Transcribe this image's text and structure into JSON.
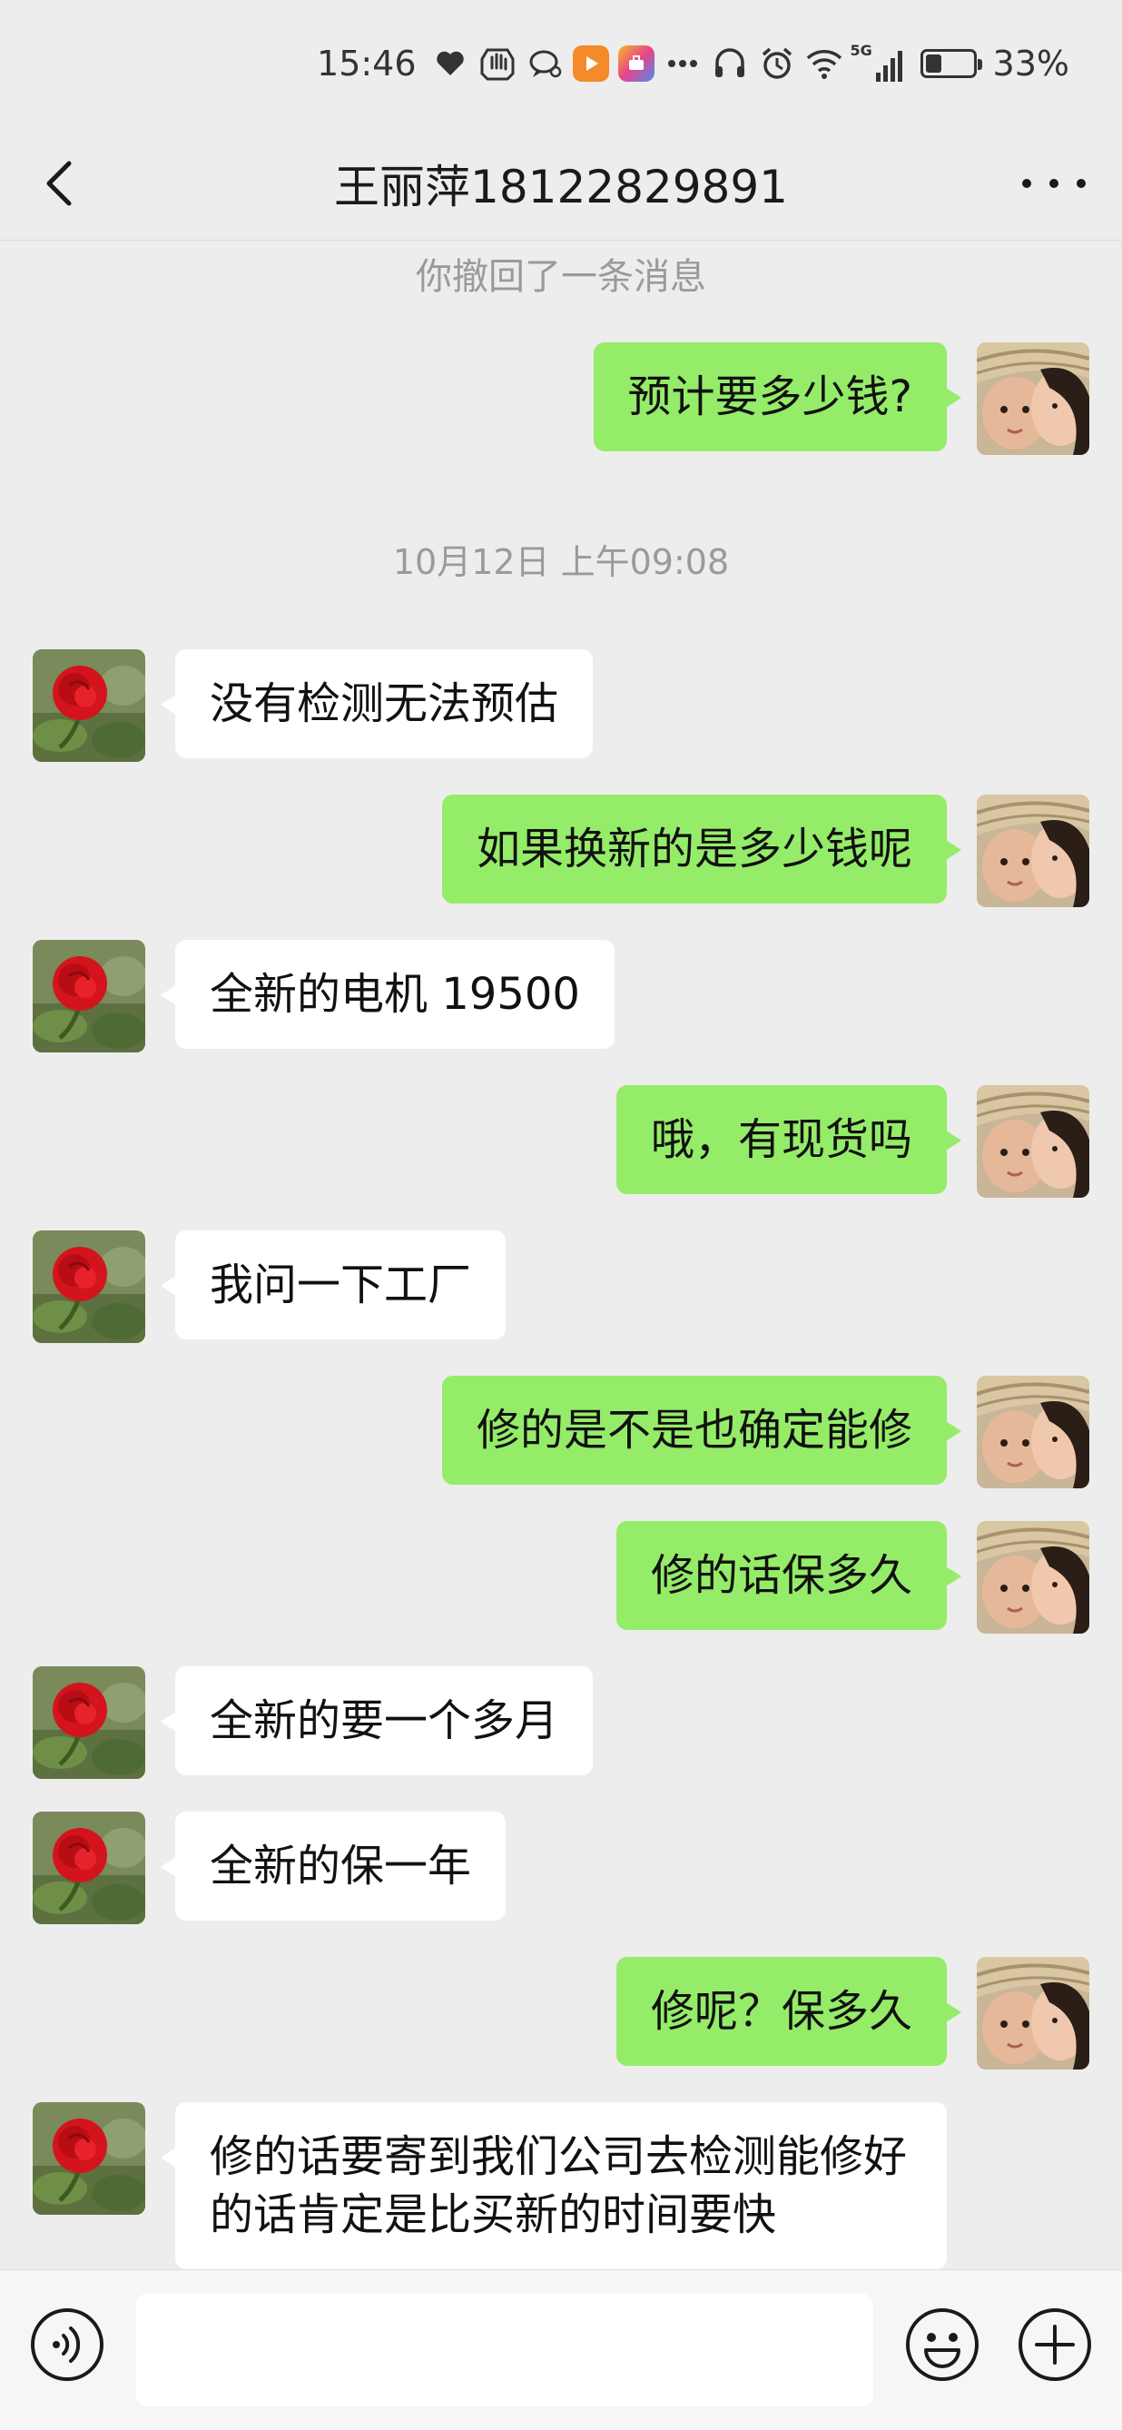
{
  "status_bar": {
    "time": "15:46",
    "network": "5G",
    "battery_percent": "33%",
    "battery_level": 0.33,
    "icons": [
      "heart-icon",
      "hand-icon",
      "chat-bubble-icon",
      "video-app-icon",
      "toolbox-app-icon",
      "more-dots-icon",
      "headphones-icon",
      "alarm-icon",
      "wifi-icon",
      "signal-icon",
      "battery-icon"
    ]
  },
  "header": {
    "title": "王丽萍18122829891",
    "back_icon": "chevron-left-icon",
    "more_icon": "more-icon"
  },
  "system_messages": {
    "recalled": "你撤回了一条消息",
    "timestamp": "10月12日 上午09:08"
  },
  "messages": [
    {
      "side": "out",
      "text": "预计要多少钱?"
    },
    {
      "side": "in",
      "text": "没有检测无法预估"
    },
    {
      "side": "out",
      "text": "如果换新的是多少钱呢"
    },
    {
      "side": "in",
      "text": "全新的电机 19500"
    },
    {
      "side": "out",
      "text": "哦，有现货吗"
    },
    {
      "side": "in",
      "text": "我问一下工厂"
    },
    {
      "side": "out",
      "text": "修的是不是也确定能修"
    },
    {
      "side": "out",
      "text": "修的话保多久"
    },
    {
      "side": "in",
      "text": "全新的要一个多月"
    },
    {
      "side": "in",
      "text": "全新的保一年"
    },
    {
      "side": "out",
      "text": "修呢？保多久"
    },
    {
      "side": "in",
      "text": "修的话要寄到我们公司去检测能修好的话肯定是比买新的时间要快"
    }
  ],
  "input_bar": {
    "input_value": "",
    "voice_icon": "voice-icon",
    "emoji_icon": "emoji-icon",
    "plus_icon": "plus-icon"
  },
  "colors": {
    "background": "#ededed",
    "outgoing_bubble": "#95ec69",
    "incoming_bubble": "#ffffff",
    "system_text": "#9a9a9a"
  }
}
